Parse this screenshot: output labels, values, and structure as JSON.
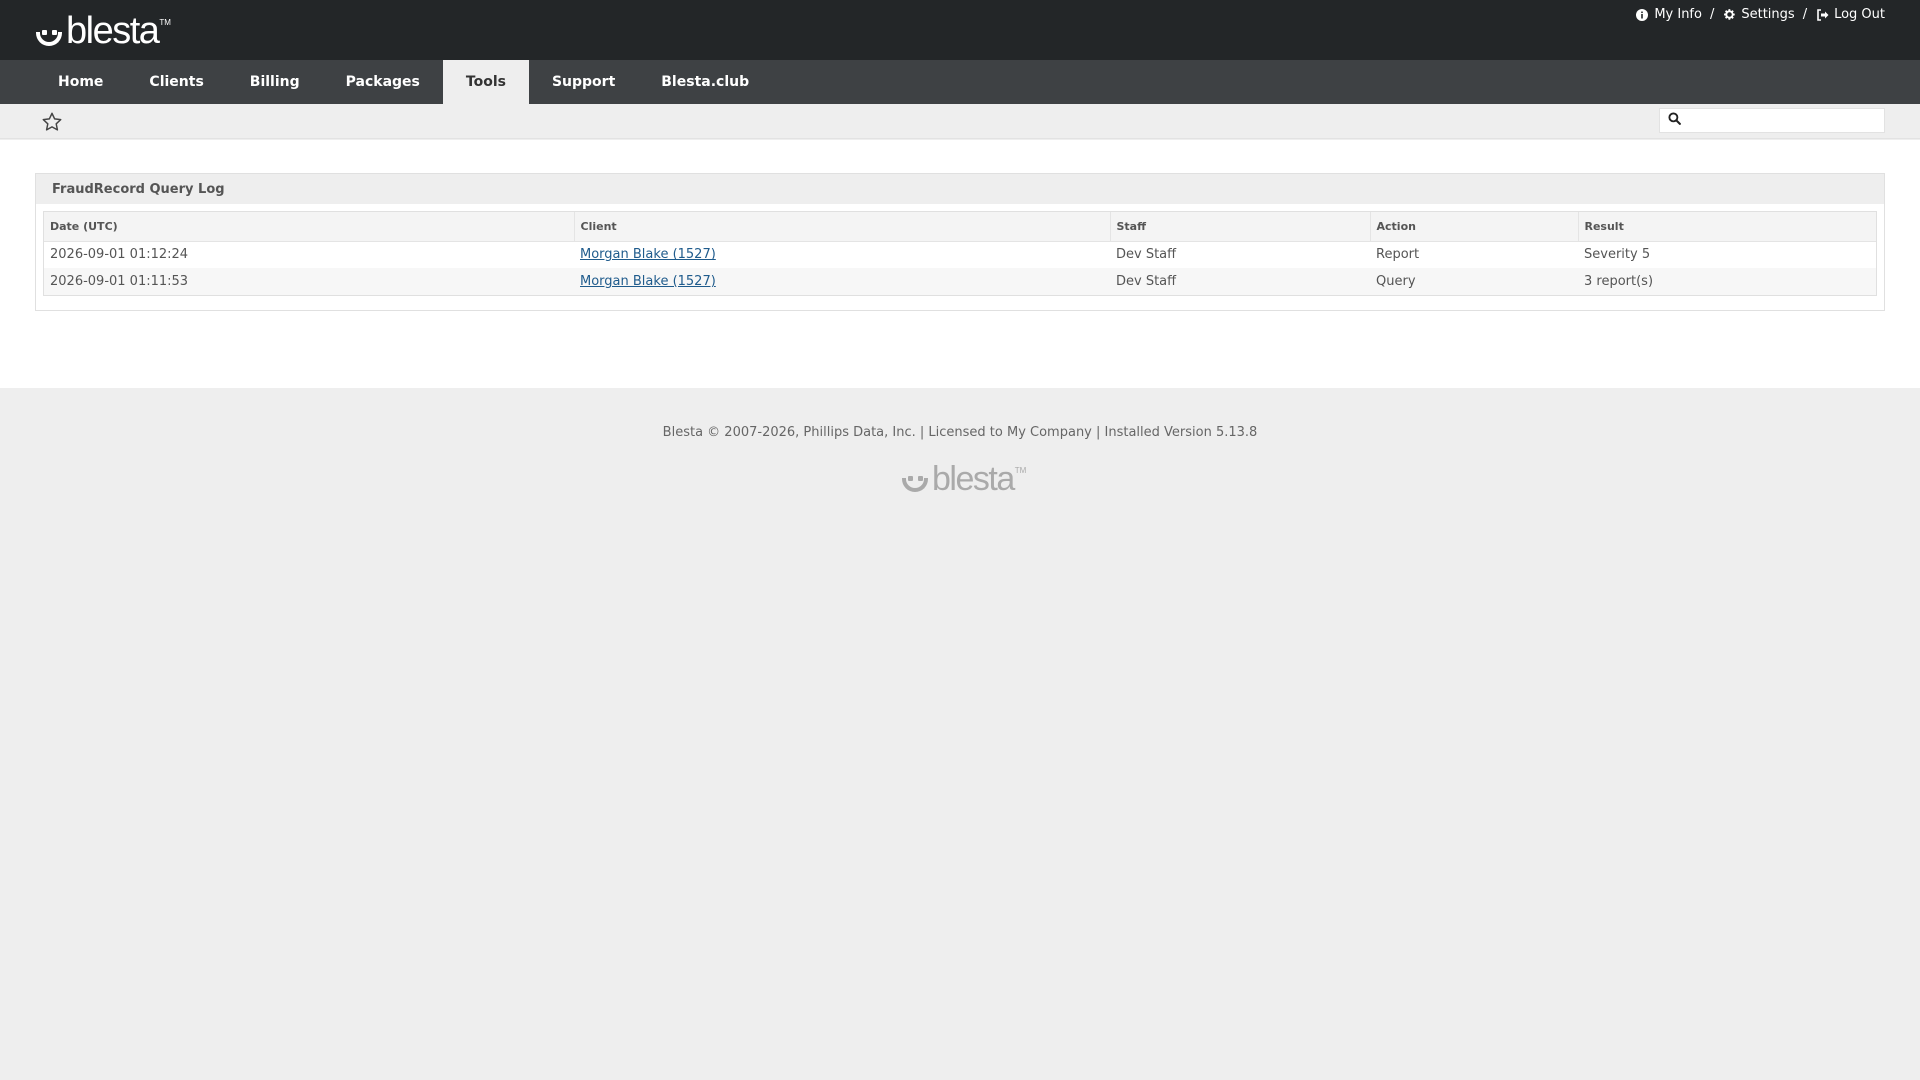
{
  "brand": {
    "name": "blesta",
    "tm": "TM"
  },
  "top_links": {
    "my_info": "My Info",
    "settings": "Settings",
    "log_out": "Log Out",
    "separator": "/"
  },
  "nav": {
    "items": [
      {
        "label": "Home",
        "active": false
      },
      {
        "label": "Clients",
        "active": false
      },
      {
        "label": "Billing",
        "active": false
      },
      {
        "label": "Packages",
        "active": false
      },
      {
        "label": "Tools",
        "active": true
      },
      {
        "label": "Support",
        "active": false
      },
      {
        "label": "Blesta.club",
        "active": false
      }
    ]
  },
  "search": {
    "value": "",
    "placeholder": ""
  },
  "panel": {
    "title": "FraudRecord Query Log",
    "columns": [
      "Date (UTC)",
      "Client",
      "Staff",
      "Action",
      "Result"
    ],
    "rows": [
      {
        "date": "2026-09-01 01:12:24",
        "client": "Morgan Blake (1527)",
        "staff": "Dev Staff",
        "action": "Report",
        "result": "Severity 5"
      },
      {
        "date": "2026-09-01 01:11:53",
        "client": "Morgan Blake (1527)",
        "staff": "Dev Staff",
        "action": "Query",
        "result": "3 report(s)"
      }
    ]
  },
  "footer": {
    "text": "Blesta © 2007-2026, Phillips Data, Inc. | Licensed to My Company | Installed Version 5.13.8"
  }
}
